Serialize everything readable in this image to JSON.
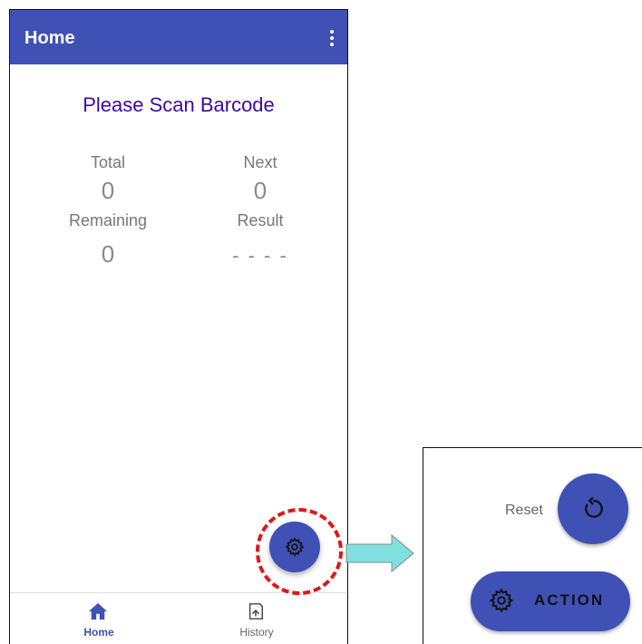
{
  "appbar": {
    "title": "Home"
  },
  "main": {
    "scan_prompt": "Please Scan Barcode",
    "stats": {
      "total_label": "Total",
      "total_value": "0",
      "next_label": "Next",
      "next_value": "0",
      "remaining_label": "Remaining",
      "remaining_value": "0",
      "result_label": "Result",
      "result_value": "- - - -"
    }
  },
  "fab": {
    "icon": "gear-icon"
  },
  "bottom_nav": {
    "items": [
      {
        "label": "Home",
        "icon": "home-icon",
        "active": true
      },
      {
        "label": "History",
        "icon": "history-icon",
        "active": false
      }
    ]
  },
  "expanded_menu": {
    "reset_label": "Reset",
    "reset_icon": "refresh-icon",
    "action_label": "ACTION",
    "action_icon": "gear-icon"
  },
  "colors": {
    "primary": "#3f51b5",
    "title_text": "#3a0aa3",
    "highlight": "#e0161a",
    "arrow": "#7fe0df"
  }
}
